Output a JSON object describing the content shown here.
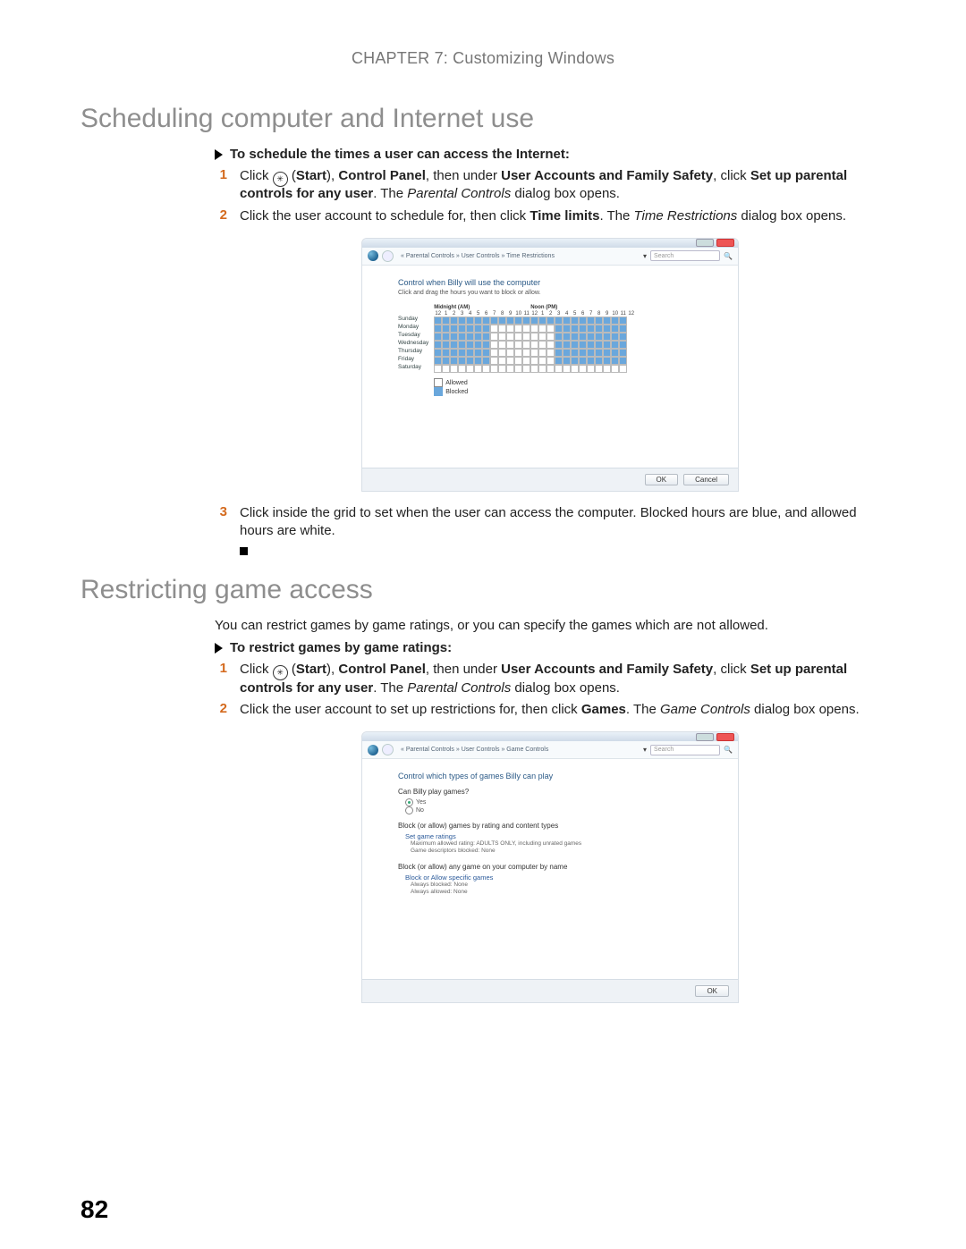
{
  "chapter_header": "CHAPTER 7: Customizing Windows",
  "section1_title": "Scheduling computer and Internet use",
  "task1_heading": "To schedule the times a user can access the Internet:",
  "task1_steps": {
    "s1": {
      "num": "1",
      "a": "Click ",
      "b": " (",
      "start": "Start",
      "c": "), ",
      "cp": "Control Panel",
      "d": ", then under ",
      "ua": "User Accounts and Family Safety",
      "e": ", click ",
      "su": "Set up parental controls for any user",
      "f": ". The ",
      "pc": "Parental Controls",
      "g": " dialog box opens."
    },
    "s2": {
      "num": "2",
      "a": "Click the user account to schedule for, then click ",
      "tl": "Time limits",
      "b": ". The ",
      "tr": "Time Restrictions",
      "c": " dialog box opens."
    },
    "s3": {
      "num": "3",
      "a": "Click inside the grid to set when the user can access the computer. Blocked hours are blue, and allowed hours are white."
    }
  },
  "screenshot1": {
    "breadcrumb": "« Parental Controls » User Controls » Time Restrictions",
    "search_placeholder": "Search",
    "title": "Control when Billy will use the computer",
    "sub": "Click and drag the hours you want to block or allow.",
    "midnight_label": "Midnight (AM)",
    "noon_label": "Noon (PM)",
    "hours": [
      "12",
      "1",
      "2",
      "3",
      "4",
      "5",
      "6",
      "7",
      "8",
      "9",
      "10",
      "11",
      "12",
      "1",
      "2",
      "3",
      "4",
      "5",
      "6",
      "7",
      "8",
      "9",
      "10",
      "11",
      "12"
    ],
    "days": [
      "Sunday",
      "Monday",
      "Tuesday",
      "Wednesday",
      "Thursday",
      "Friday",
      "Saturday"
    ],
    "blocked": {
      "Sunday": [
        1,
        1,
        1,
        1,
        1,
        1,
        1,
        1,
        1,
        1,
        1,
        1,
        1,
        1,
        1,
        1,
        1,
        1,
        1,
        1,
        1,
        1,
        1,
        1
      ],
      "Monday": [
        1,
        1,
        1,
        1,
        1,
        1,
        1,
        0,
        0,
        0,
        0,
        0,
        0,
        0,
        0,
        1,
        1,
        1,
        1,
        1,
        1,
        1,
        1,
        1
      ],
      "Tuesday": [
        1,
        1,
        1,
        1,
        1,
        1,
        1,
        0,
        0,
        0,
        0,
        0,
        0,
        0,
        0,
        1,
        1,
        1,
        1,
        1,
        1,
        1,
        1,
        1
      ],
      "Wednesday": [
        1,
        1,
        1,
        1,
        1,
        1,
        1,
        0,
        0,
        0,
        0,
        0,
        0,
        0,
        0,
        1,
        1,
        1,
        1,
        1,
        1,
        1,
        1,
        1
      ],
      "Thursday": [
        1,
        1,
        1,
        1,
        1,
        1,
        1,
        0,
        0,
        0,
        0,
        0,
        0,
        0,
        0,
        1,
        1,
        1,
        1,
        1,
        1,
        1,
        1,
        1
      ],
      "Friday": [
        1,
        1,
        1,
        1,
        1,
        1,
        1,
        0,
        0,
        0,
        0,
        0,
        0,
        0,
        0,
        1,
        1,
        1,
        1,
        1,
        1,
        1,
        1,
        1
      ],
      "Saturday": [
        0,
        0,
        0,
        0,
        0,
        0,
        0,
        0,
        0,
        0,
        0,
        0,
        0,
        0,
        0,
        0,
        0,
        0,
        0,
        0,
        0,
        0,
        0,
        0
      ]
    },
    "legend_allowed": "Allowed",
    "legend_blocked": "Blocked",
    "btn_ok": "OK",
    "btn_cancel": "Cancel"
  },
  "section2_title": "Restricting game access",
  "section2_intro": "You can restrict games by game ratings, or you can specify the games which are not allowed.",
  "task2_heading": "To restrict games by game ratings:",
  "task2_steps": {
    "s1": {
      "num": "1",
      "a": "Click ",
      "b": " (",
      "start": "Start",
      "c": "), ",
      "cp": "Control Panel",
      "d": ", then under ",
      "ua": "User Accounts and Family Safety",
      "e": ", click ",
      "su": "Set up parental controls for any user",
      "f": ". The ",
      "pc": "Parental Controls",
      "g": " dialog box opens."
    },
    "s2": {
      "num": "2",
      "a": "Click the user account to set up restrictions for, then click ",
      "gm": "Games",
      "b": ". The ",
      "gc": "Game Controls",
      "c": " dialog box opens."
    }
  },
  "screenshot2": {
    "breadcrumb": "« Parental Controls » User Controls » Game Controls",
    "search_placeholder": "Search",
    "title": "Control which types of games Billy can play",
    "q1": "Can Billy play games?",
    "r_yes": "Yes",
    "r_no": "No",
    "q2": "Block (or allow) games by rating and content types",
    "link1": "Set game ratings",
    "detail1a": "Maximum allowed rating: ADULTS ONLY, including unrated games",
    "detail1b": "Game descriptors blocked: None",
    "q3": "Block (or allow) any game on your computer by name",
    "link2": "Block or Allow specific games",
    "detail2a": "Always blocked: None",
    "detail2b": "Always allowed: None",
    "btn_ok": "OK"
  },
  "page_number": "82"
}
